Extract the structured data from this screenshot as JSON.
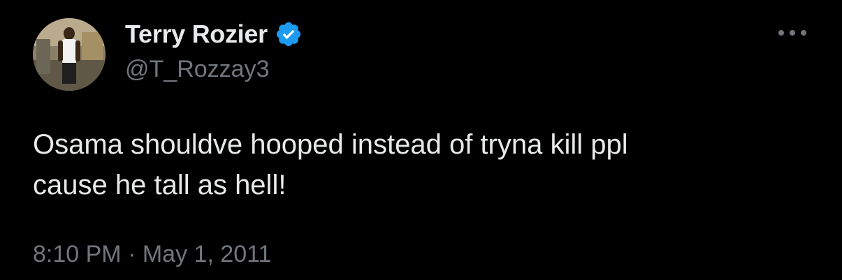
{
  "author": {
    "display_name": "Terry Rozier",
    "handle": "@T_Rozzay3",
    "verified": true,
    "verified_color": "#1d9bf0"
  },
  "tweet": {
    "text": "Osama shouldve hooped instead of tryna kill ppl\ncause he tall as hell!",
    "time": "8:10 PM",
    "separator": "·",
    "date": "May 1, 2011"
  },
  "icons": {
    "more": "more-horizontal-icon",
    "verified": "verified-badge-icon"
  }
}
